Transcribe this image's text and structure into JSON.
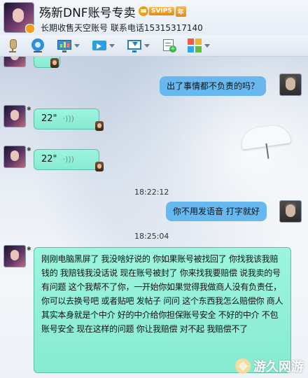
{
  "header": {
    "title": "殇新DNF账号专卖",
    "vip_label": "SVIP5",
    "vip_year": "年",
    "subtitle": "长期收售天空账号  联系电话15315317140"
  },
  "toolbar": {
    "items": [
      {
        "icon": "microphone-icon"
      },
      {
        "icon": "camera-icon"
      },
      {
        "icon": "screen-share-icon"
      },
      {
        "icon": "file-transfer-icon"
      },
      {
        "icon": "remote-desktop-icon"
      },
      {
        "icon": "note-add-icon"
      },
      {
        "icon": "apps-icon"
      }
    ]
  },
  "messages": [
    {
      "sender": "self",
      "type": "text",
      "text": "出了事情都不负责的吗？"
    },
    {
      "sender": "customer",
      "type": "voice",
      "duration": "22\""
    },
    {
      "sender": "customer",
      "type": "voice",
      "duration": "22\""
    },
    {
      "type": "timestamp",
      "text": "18:22:12"
    },
    {
      "sender": "self",
      "type": "text",
      "text": "你不用发语音 打字就好"
    },
    {
      "type": "timestamp",
      "text": "18:25:04"
    },
    {
      "sender": "customer",
      "type": "text",
      "text": "刚刚电脑黑屏了  我没啥好说的 你如果账号被找回了 你找我该我赔钱的 我赔钱我没话说 现在账号被封了 你来找我要赔偿 说我卖的号 有问题 这个我帮不了你，一开始你如果觉得我做商人没有负责任，你可以去换号吧 或者贴吧 发帖子 问问 这个东西我怎么赔偿你 商人其实本身就是个中介 好的中介给你担保账号安全 不好的中介 不包账号安全 现在这样的问题 你让我赔偿 对不起 我赔偿不了"
    }
  ],
  "watermark": "游久网游",
  "colors": {
    "customer_bubble": "#8ff0d8",
    "self_bubble": "#67b8ef"
  }
}
